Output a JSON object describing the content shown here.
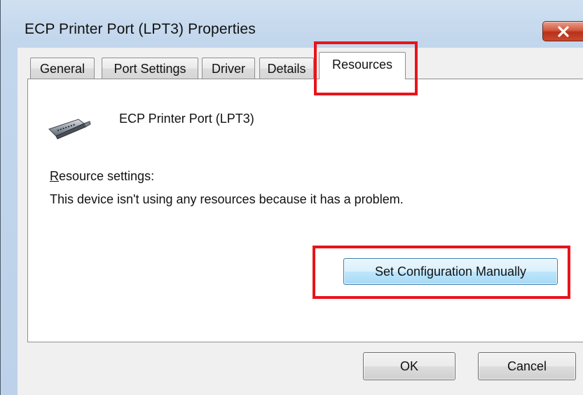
{
  "window": {
    "title": "ECP Printer Port (LPT3) Properties",
    "close_icon": "close-x-icon"
  },
  "tabs": [
    {
      "label": "General",
      "active": false
    },
    {
      "label": "Port Settings",
      "active": false
    },
    {
      "label": "Driver",
      "active": false
    },
    {
      "label": "Details",
      "active": false
    },
    {
      "label": "Resources",
      "active": true
    }
  ],
  "panel": {
    "device_icon": "parallel-port-icon",
    "device_name": "ECP Printer Port (LPT3)",
    "resource_settings_label_mnemonic": "R",
    "resource_settings_label_rest": "esource settings:",
    "resource_message": "This device isn't using any resources because it has a problem.",
    "set_config_button": "Set Configuration Manually"
  },
  "footer": {
    "ok_label": "OK",
    "cancel_label": "Cancel"
  },
  "annotations": {
    "highlight_color": "#e8141b"
  }
}
